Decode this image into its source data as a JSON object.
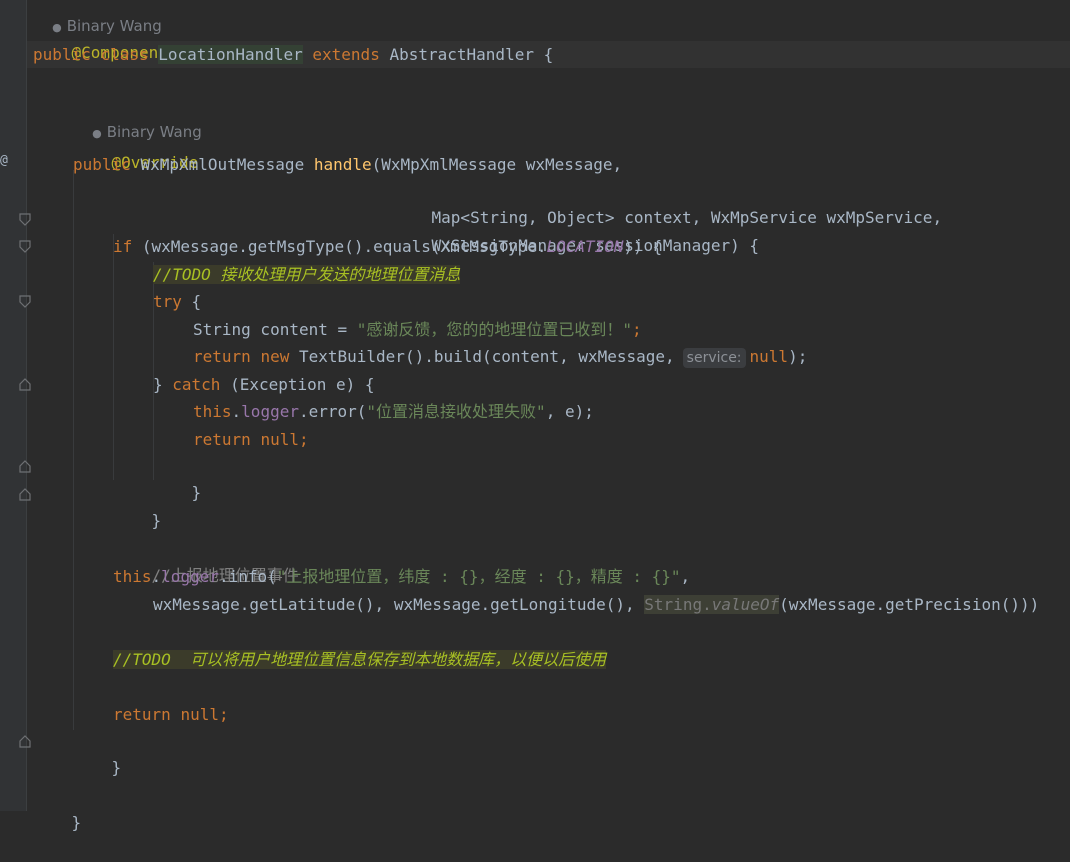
{
  "author_hints": {
    "class": "Binary Wang",
    "method": "Binary Wang"
  },
  "code": {
    "l01": "@Component",
    "l02": {
      "public": "public",
      "class": "class",
      "name": "LocationHandler",
      "extends": "extends",
      "parent": "AbstractHandler",
      "brace": " {"
    },
    "l04": "@Override",
    "l05": {
      "public": "public",
      "ret": "WxMpXmlOutMessage",
      "mname": "handle",
      "params": "(WxMpXmlMessage wxMessage,"
    },
    "l06": "Map<String, Object> context, WxMpService wxMpService,",
    "l07": "WxSessionManager sessionManager) {",
    "l08": {
      "if": "if",
      "cond": " (wxMessage.getMsgType().equals(XmlMsgType.",
      "const": "LOCATION",
      "close": ")) {"
    },
    "l09": {
      "slashes": "//",
      "todo": "TODO 接收处理用户发送的地理位置消息"
    },
    "l10": {
      "try": "try",
      "brace": " {"
    },
    "l11": {
      "decl": "String content = ",
      "str": "\"感谢反馈，您的的地理位置已收到！\"",
      "semi": ";"
    },
    "l12": {
      "return": "return",
      "new": "new",
      "call": " TextBuilder().build(content, wxMessage,",
      "param_hint": "service:",
      "null": "null",
      "end": ");"
    },
    "l13": {
      "open": "} ",
      "catch": "catch",
      "rest": " (Exception e) {"
    },
    "l14": {
      "this": "this",
      "field": "logger",
      "call": ".error(",
      "str": "\"位置消息接收处理失败\"",
      "end": ", e);"
    },
    "l15": {
      "return": "return",
      "null": "null",
      "semi": ";"
    },
    "l16": "}",
    "l17": "}",
    "l19": "//上报地理位置事件",
    "l20": {
      "this": "this",
      "field": "logger",
      "call": ".info(",
      "str": "\"上报地理位置，纬度 : {}，经度 : {}，精度 : {}\"",
      "comma": ","
    },
    "l21": {
      "args": "wxMessage.getLatitude(), wxMessage.getLongitude(), ",
      "string": "String.",
      "valueof": "valueOf",
      "tail": "(wxMessage.getPrecision()))"
    },
    "l23": {
      "slashes": "//",
      "todo": "TODO  可以将用户地理位置信息保存到本地数据库，以便以后使用"
    },
    "l25": {
      "return": "return",
      "null": "null",
      "semi": ";"
    },
    "l26": "}",
    "l28": "}"
  },
  "gutter": {
    "override_marker": "@"
  },
  "colors": {
    "background": "#2b2b2b",
    "keyword": "#cc7832",
    "annotation": "#bbb529",
    "string": "#6a8759",
    "method": "#ffc66d",
    "field": "#9876aa",
    "todo": "#a8c023"
  }
}
